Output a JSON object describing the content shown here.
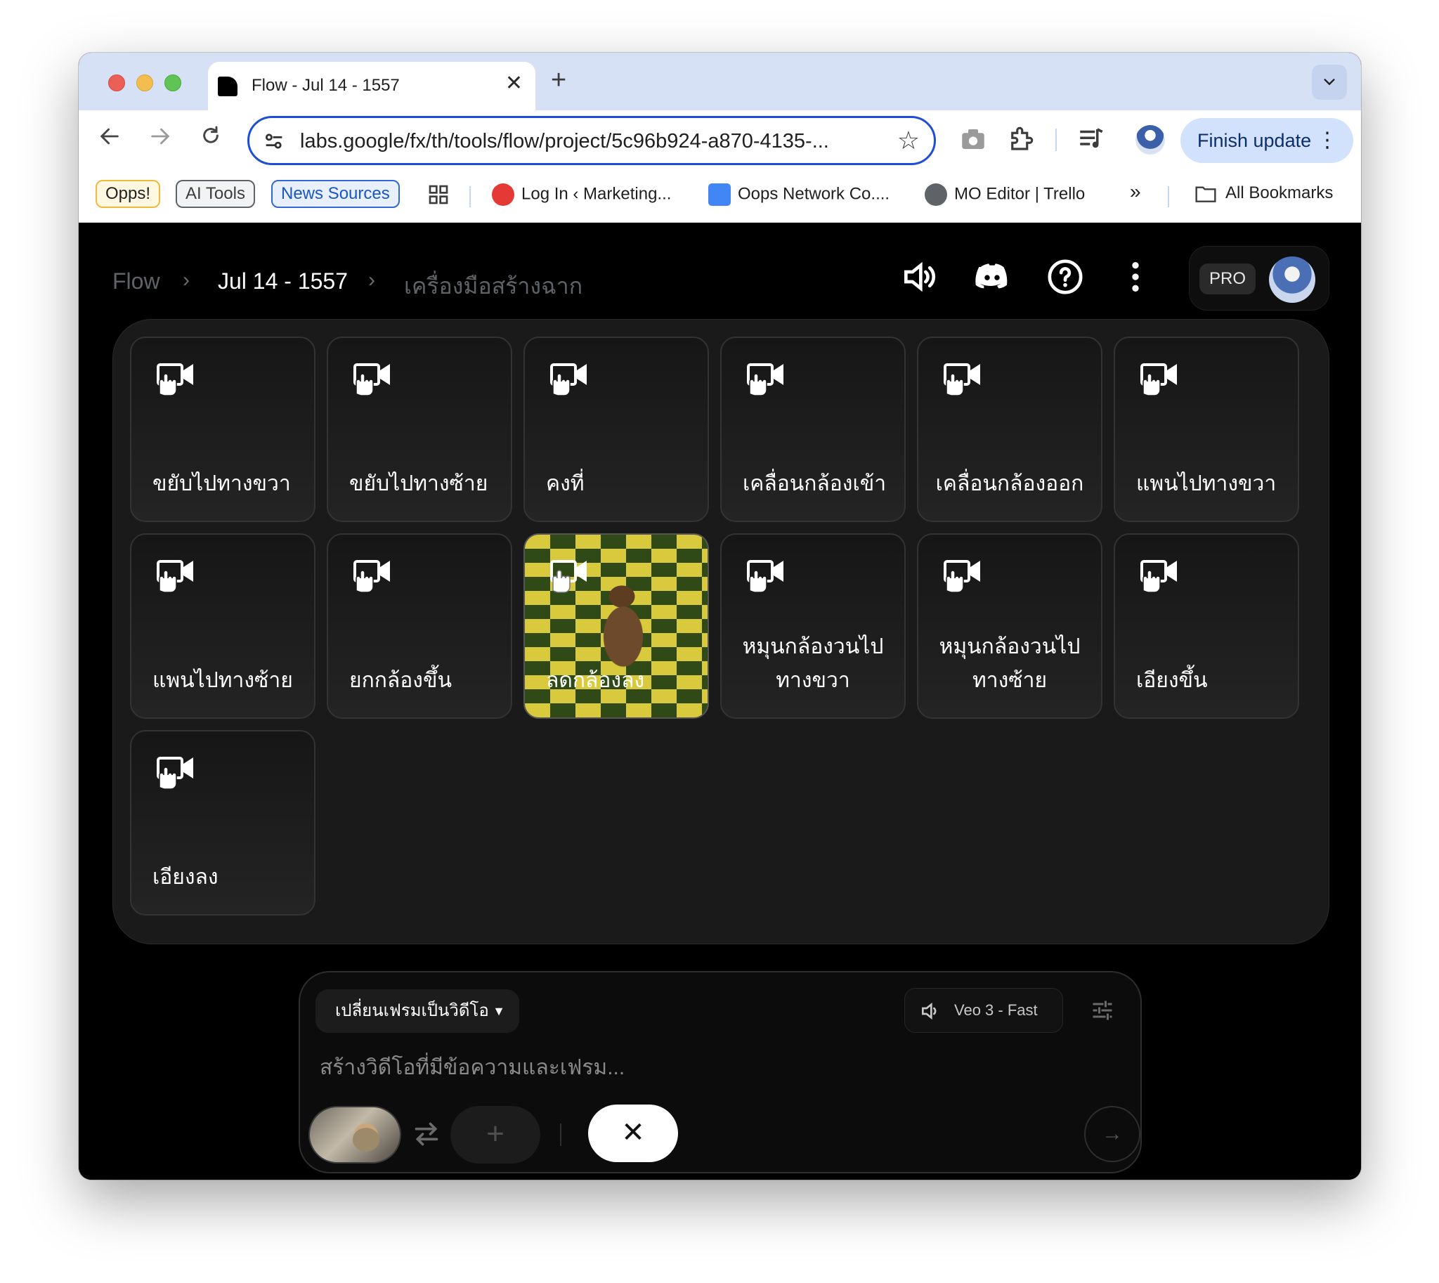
{
  "browser": {
    "tab": {
      "title": "Flow - Jul 14 - 1557",
      "close": "✕",
      "new_tab": "+"
    },
    "tab_search_icon": "chevron-down-icon",
    "omnibox": {
      "url": "labs.google/fx/th/tools/flow/project/5c96b924-a870-4135-..."
    },
    "finish_update": "Finish update",
    "bookmarks": {
      "chips": [
        "Opps!",
        "AI Tools",
        "News Sources"
      ],
      "items": [
        "Log In ‹ Marketing...",
        "Oops Network Co....",
        "MO Editor | Trello"
      ],
      "overflow": "»",
      "all_bookmarks": "All Bookmarks"
    }
  },
  "app": {
    "breadcrumb": {
      "root": "Flow",
      "project": "Jul 14 - 1557",
      "tool": "เครื่องมือสร้างฉาก",
      "separator": "›"
    },
    "pro_badge": "PRO",
    "camera_motions": [
      {
        "label": "ขยับไปทางขวา"
      },
      {
        "label": "ขยับไปทางซ้าย"
      },
      {
        "label": "คงที่"
      },
      {
        "label": "เคลื่อนกล้องเข้า"
      },
      {
        "label": "เคลื่อนกล้องออก"
      },
      {
        "label": "แพนไปทางขวา"
      },
      {
        "label": "แพนไปทางซ้าย"
      },
      {
        "label": "ยกกล้องขึ้น"
      },
      {
        "label": "ลดกล้องลง",
        "has_preview": true
      },
      {
        "label": "หมุนกล้องวนไปทางขวา"
      },
      {
        "label": "หมุนกล้องวนไปทางซ้าย"
      },
      {
        "label": "เอียงขึ้น"
      },
      {
        "label": "เอียงลง"
      }
    ],
    "composer": {
      "mode": "เปลี่ยนเฟรมเป็นวิดีโอ",
      "model": "Veo 3 - Fast",
      "placeholder": "สร้างวิดีโอที่มีข้อความและเฟรม...",
      "add_label": "+",
      "close_label": "✕",
      "send_label": "→"
    }
  },
  "colors": {
    "accent": "#1d4ed8",
    "app_bg": "#000000",
    "panel_bg": "#1a1a1a",
    "finish_bg": "#d3e2fc"
  }
}
